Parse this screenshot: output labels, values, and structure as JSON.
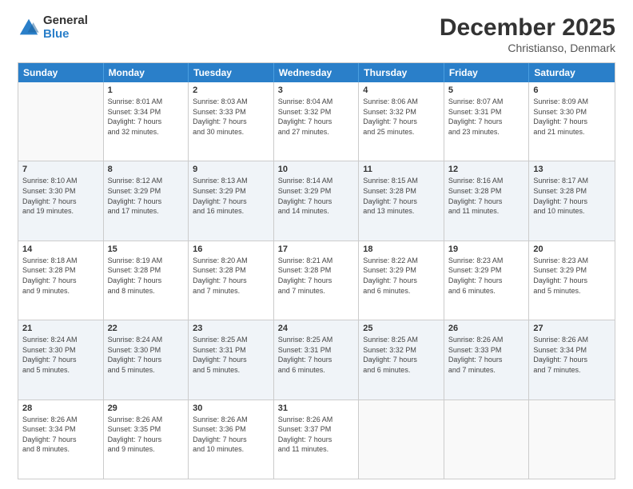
{
  "logo": {
    "general": "General",
    "blue": "Blue"
  },
  "header": {
    "month": "December 2025",
    "location": "Christianso, Denmark"
  },
  "weekdays": [
    "Sunday",
    "Monday",
    "Tuesday",
    "Wednesday",
    "Thursday",
    "Friday",
    "Saturday"
  ],
  "rows": [
    [
      {
        "day": "",
        "info": ""
      },
      {
        "day": "1",
        "info": "Sunrise: 8:01 AM\nSunset: 3:34 PM\nDaylight: 7 hours\nand 32 minutes."
      },
      {
        "day": "2",
        "info": "Sunrise: 8:03 AM\nSunset: 3:33 PM\nDaylight: 7 hours\nand 30 minutes."
      },
      {
        "day": "3",
        "info": "Sunrise: 8:04 AM\nSunset: 3:32 PM\nDaylight: 7 hours\nand 27 minutes."
      },
      {
        "day": "4",
        "info": "Sunrise: 8:06 AM\nSunset: 3:32 PM\nDaylight: 7 hours\nand 25 minutes."
      },
      {
        "day": "5",
        "info": "Sunrise: 8:07 AM\nSunset: 3:31 PM\nDaylight: 7 hours\nand 23 minutes."
      },
      {
        "day": "6",
        "info": "Sunrise: 8:09 AM\nSunset: 3:30 PM\nDaylight: 7 hours\nand 21 minutes."
      }
    ],
    [
      {
        "day": "7",
        "info": "Sunrise: 8:10 AM\nSunset: 3:30 PM\nDaylight: 7 hours\nand 19 minutes."
      },
      {
        "day": "8",
        "info": "Sunrise: 8:12 AM\nSunset: 3:29 PM\nDaylight: 7 hours\nand 17 minutes."
      },
      {
        "day": "9",
        "info": "Sunrise: 8:13 AM\nSunset: 3:29 PM\nDaylight: 7 hours\nand 16 minutes."
      },
      {
        "day": "10",
        "info": "Sunrise: 8:14 AM\nSunset: 3:29 PM\nDaylight: 7 hours\nand 14 minutes."
      },
      {
        "day": "11",
        "info": "Sunrise: 8:15 AM\nSunset: 3:28 PM\nDaylight: 7 hours\nand 13 minutes."
      },
      {
        "day": "12",
        "info": "Sunrise: 8:16 AM\nSunset: 3:28 PM\nDaylight: 7 hours\nand 11 minutes."
      },
      {
        "day": "13",
        "info": "Sunrise: 8:17 AM\nSunset: 3:28 PM\nDaylight: 7 hours\nand 10 minutes."
      }
    ],
    [
      {
        "day": "14",
        "info": "Sunrise: 8:18 AM\nSunset: 3:28 PM\nDaylight: 7 hours\nand 9 minutes."
      },
      {
        "day": "15",
        "info": "Sunrise: 8:19 AM\nSunset: 3:28 PM\nDaylight: 7 hours\nand 8 minutes."
      },
      {
        "day": "16",
        "info": "Sunrise: 8:20 AM\nSunset: 3:28 PM\nDaylight: 7 hours\nand 7 minutes."
      },
      {
        "day": "17",
        "info": "Sunrise: 8:21 AM\nSunset: 3:28 PM\nDaylight: 7 hours\nand 7 minutes."
      },
      {
        "day": "18",
        "info": "Sunrise: 8:22 AM\nSunset: 3:29 PM\nDaylight: 7 hours\nand 6 minutes."
      },
      {
        "day": "19",
        "info": "Sunrise: 8:23 AM\nSunset: 3:29 PM\nDaylight: 7 hours\nand 6 minutes."
      },
      {
        "day": "20",
        "info": "Sunrise: 8:23 AM\nSunset: 3:29 PM\nDaylight: 7 hours\nand 5 minutes."
      }
    ],
    [
      {
        "day": "21",
        "info": "Sunrise: 8:24 AM\nSunset: 3:30 PM\nDaylight: 7 hours\nand 5 minutes."
      },
      {
        "day": "22",
        "info": "Sunrise: 8:24 AM\nSunset: 3:30 PM\nDaylight: 7 hours\nand 5 minutes."
      },
      {
        "day": "23",
        "info": "Sunrise: 8:25 AM\nSunset: 3:31 PM\nDaylight: 7 hours\nand 5 minutes."
      },
      {
        "day": "24",
        "info": "Sunrise: 8:25 AM\nSunset: 3:31 PM\nDaylight: 7 hours\nand 6 minutes."
      },
      {
        "day": "25",
        "info": "Sunrise: 8:25 AM\nSunset: 3:32 PM\nDaylight: 7 hours\nand 6 minutes."
      },
      {
        "day": "26",
        "info": "Sunrise: 8:26 AM\nSunset: 3:33 PM\nDaylight: 7 hours\nand 7 minutes."
      },
      {
        "day": "27",
        "info": "Sunrise: 8:26 AM\nSunset: 3:34 PM\nDaylight: 7 hours\nand 7 minutes."
      }
    ],
    [
      {
        "day": "28",
        "info": "Sunrise: 8:26 AM\nSunset: 3:34 PM\nDaylight: 7 hours\nand 8 minutes."
      },
      {
        "day": "29",
        "info": "Sunrise: 8:26 AM\nSunset: 3:35 PM\nDaylight: 7 hours\nand 9 minutes."
      },
      {
        "day": "30",
        "info": "Sunrise: 8:26 AM\nSunset: 3:36 PM\nDaylight: 7 hours\nand 10 minutes."
      },
      {
        "day": "31",
        "info": "Sunrise: 8:26 AM\nSunset: 3:37 PM\nDaylight: 7 hours\nand 11 minutes."
      },
      {
        "day": "",
        "info": ""
      },
      {
        "day": "",
        "info": ""
      },
      {
        "day": "",
        "info": ""
      }
    ]
  ]
}
